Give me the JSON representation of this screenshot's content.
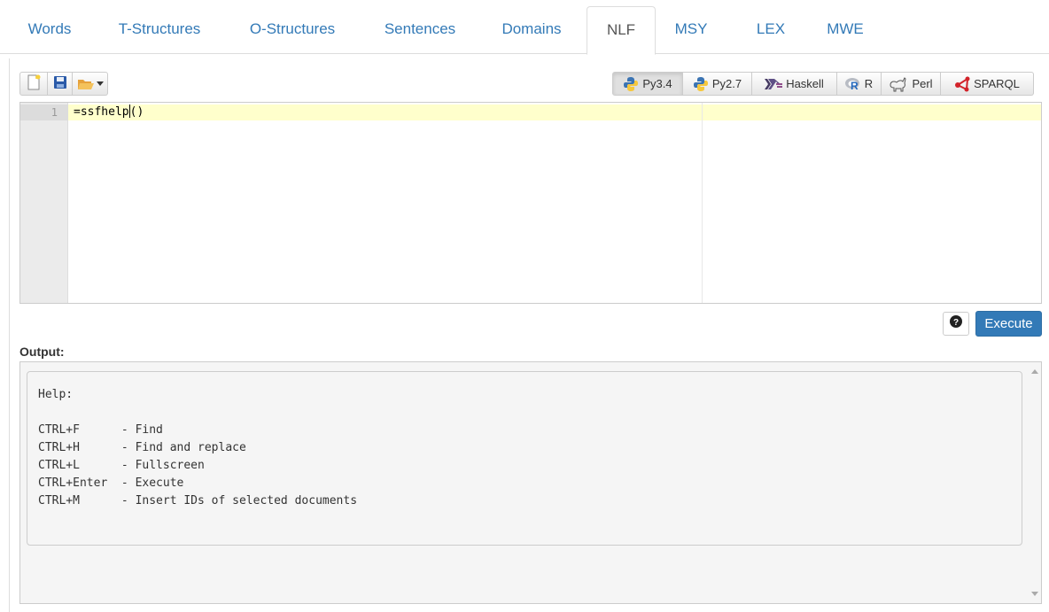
{
  "tabs": [
    {
      "label": "Words",
      "active": false
    },
    {
      "label": "T-Structures",
      "active": false
    },
    {
      "label": "O-Structures",
      "active": false
    },
    {
      "label": "Sentences",
      "active": false
    },
    {
      "label": "Domains",
      "active": false
    },
    {
      "label": "NLF",
      "active": true
    },
    {
      "label": "MSY",
      "active": false
    },
    {
      "label": "LEX",
      "active": false
    },
    {
      "label": "MWE",
      "active": false
    }
  ],
  "toolbar": {
    "file_buttons": [
      {
        "icon": "new-file-icon"
      },
      {
        "icon": "save-icon"
      },
      {
        "icon": "open-folder-icon"
      }
    ],
    "languages": [
      {
        "label": "Py3.4",
        "icon": "python-icon",
        "active": true
      },
      {
        "label": "Py2.7",
        "icon": "python-icon",
        "active": false
      },
      {
        "label": "Haskell",
        "icon": "haskell-icon",
        "active": false
      },
      {
        "label": "R",
        "icon": "r-icon",
        "active": false
      },
      {
        "label": "Perl",
        "icon": "perl-icon",
        "active": false
      },
      {
        "label": "SPARQL",
        "icon": "sparql-icon",
        "active": false
      }
    ]
  },
  "editor": {
    "line_number": "1",
    "code_before_cursor": "=ssfhelp",
    "code_after_cursor": "()"
  },
  "actions": {
    "help_icon": "question-circle-icon",
    "execute_label": "Execute"
  },
  "output": {
    "label": "Output:",
    "lines": [
      "Help:",
      "",
      "CTRL+F      - Find",
      "CTRL+H      - Find and replace",
      "CTRL+L      - Fullscreen",
      "CTRL+Enter  - Execute",
      "CTRL+M      - Insert IDs of selected documents"
    ]
  },
  "colors": {
    "link": "#337ab7",
    "primary_button": "#337ab7",
    "active_line": "#ffffcc"
  }
}
